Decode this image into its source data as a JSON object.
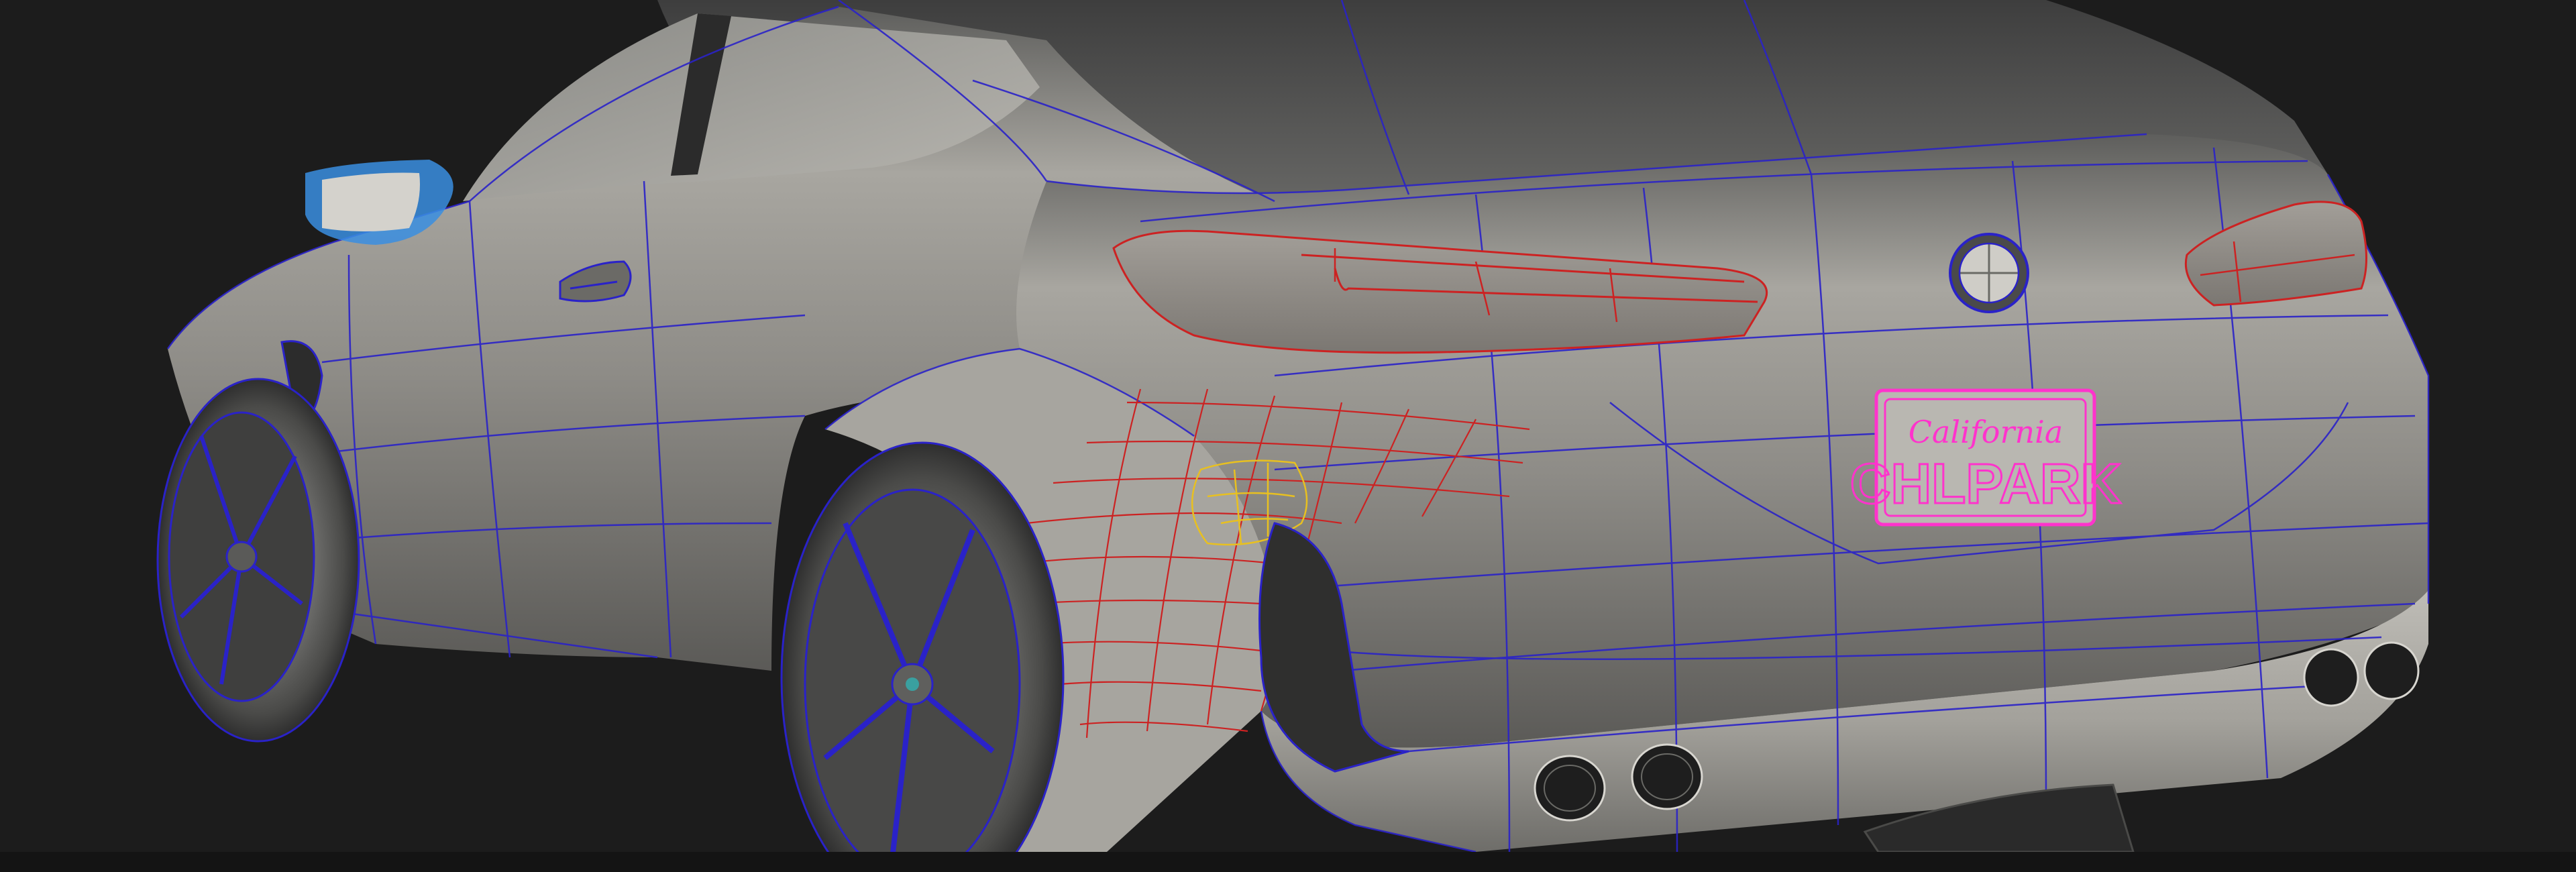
{
  "viewport": {
    "name": "3D modeling viewport",
    "background": "#1c1c1c",
    "display_mode": "shaded with wireframe"
  },
  "colors": {
    "surface": "#8f8d88",
    "surface_light": "#c8c6c0",
    "surface_dark": "#4a4a4a",
    "wire": "#2a22c8",
    "selected_wire": "#cc2222",
    "active_point": "#e8c020",
    "plate_outline": "#ff33cc",
    "mirror_highlight": "#3a8ee0"
  },
  "license_plate": {
    "state": "California",
    "number": "CHLPARK"
  },
  "objects": {
    "car_body": "car-body",
    "rear_wheel_left": "wheel",
    "rear_wheel_right": "wheel",
    "taillight_left": "taillight",
    "taillight_right": "taillight",
    "badge": "roundel-badge",
    "side_mirror": "side-mirror",
    "exhausts": "exhaust-tips",
    "selected_patch": "selected-surface-patch"
  }
}
